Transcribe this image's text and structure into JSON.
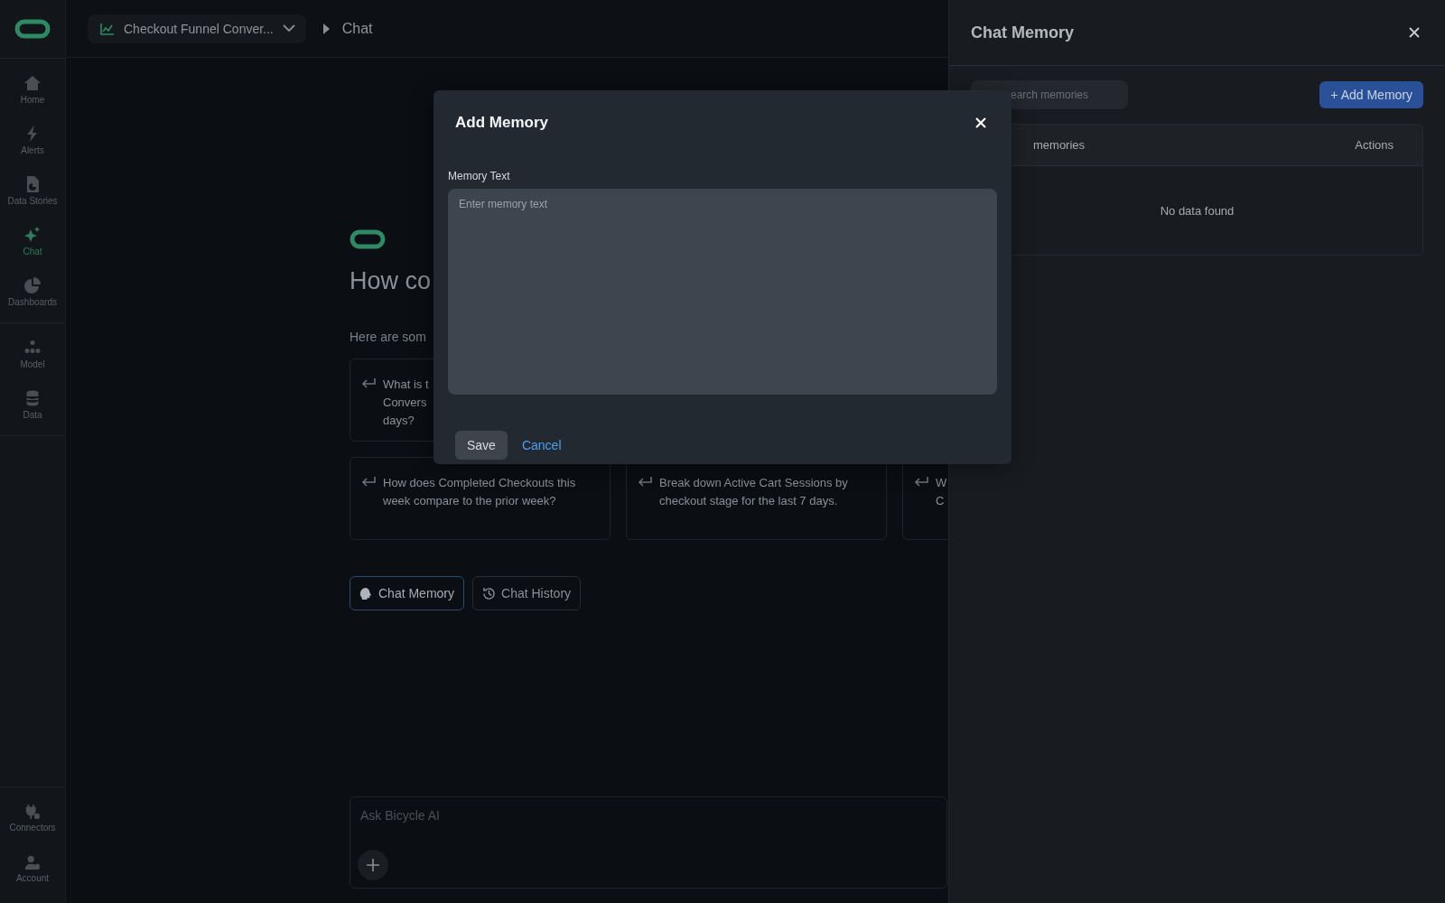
{
  "topbar": {
    "dataset": "Checkout Funnel Conver...",
    "page": "Chat"
  },
  "sidebar": {
    "groups": [
      [
        {
          "label": "Home",
          "selected": false
        },
        {
          "label": "Alerts",
          "selected": false
        },
        {
          "label": "Data Stories",
          "selected": false
        },
        {
          "label": "Chat",
          "selected": true
        },
        {
          "label": "Dashboards",
          "selected": false
        }
      ],
      [
        {
          "label": "Model",
          "selected": false
        },
        {
          "label": "Data",
          "selected": false
        }
      ]
    ],
    "bottom_items": [
      {
        "label": "Connectors",
        "selected": false
      },
      {
        "label": "Account",
        "selected": false
      }
    ]
  },
  "main": {
    "heading": "How co",
    "subheading": "Here are som",
    "suggestions": [
      {
        "lines": [
          "What is t",
          "Convers",
          "days?"
        ]
      },
      {
        "lines": [
          "How does Completed Checkouts this",
          "week compare to the prior week?"
        ]
      },
      {
        "lines": [
          "Break down Active Cart Sessions by",
          "checkout stage for the last 7 days."
        ]
      },
      {
        "lines": [
          "W",
          "C"
        ]
      }
    ],
    "buttons": [
      {
        "label": "Chat Memory",
        "selected": true
      },
      {
        "label": "Chat History",
        "selected": false
      }
    ],
    "input": {
      "placeholder": "Ask Bicycle AI"
    }
  },
  "panel": {
    "title": "Chat Memory",
    "search": {
      "placeholder": "earch memories"
    },
    "add_button": "+ Add Memory",
    "table": {
      "columns": [
        "memories",
        "Actions"
      ],
      "empty": "No data found"
    }
  },
  "modal": {
    "title": "Add Memory",
    "field_label": "Memory Text",
    "textarea": {
      "placeholder": "Enter memory text"
    },
    "buttons": [
      {
        "label": "Save",
        "kind": "secondary"
      },
      {
        "label": "Cancel",
        "kind": "link"
      }
    ]
  }
}
